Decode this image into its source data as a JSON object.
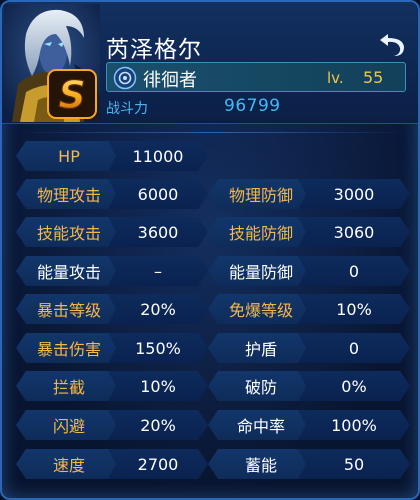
{
  "hero": {
    "name": "芮泽格尔",
    "class_name": "徘徊者",
    "level_label": "lv.",
    "level": "55",
    "rank": "S",
    "power_label": "战斗力",
    "power": "96799"
  },
  "stats": {
    "hp": {
      "label": "HP",
      "value": "11000"
    },
    "rows": [
      {
        "left_label": "物理攻击",
        "left_value": "6000",
        "right_label": "物理防御",
        "right_value": "3000"
      },
      {
        "left_label": "技能攻击",
        "left_value": "3600",
        "right_label": "技能防御",
        "right_value": "3060"
      },
      {
        "left_label": "能量攻击",
        "left_value": "–",
        "right_label": "能量防御",
        "right_value": "0"
      },
      {
        "left_label": "暴击等级",
        "left_value": "20%",
        "right_label": "免爆等级",
        "right_value": "10%"
      },
      {
        "left_label": "暴击伤害",
        "left_value": "150%",
        "right_label": "护盾",
        "right_value": "0"
      },
      {
        "left_label": "拦截",
        "left_value": "10%",
        "right_label": "破防",
        "right_value": "0%"
      },
      {
        "left_label": "闪避",
        "left_value": "20%",
        "right_label": "命中率",
        "right_value": "100%"
      },
      {
        "left_label": "速度",
        "left_value": "2700",
        "right_label": "蓄能",
        "right_value": "50"
      }
    ]
  },
  "colors": {
    "label_orange": "#f5b84a",
    "label_white": "#ffffff",
    "power_blue": "#43b9f5",
    "level_gold": "#f0c64a",
    "rank_gold": "#f7a81b"
  },
  "icons": {
    "back": "back-arrow-icon",
    "class": "class-emblem-icon",
    "rank": "rank-s-badge-icon"
  }
}
